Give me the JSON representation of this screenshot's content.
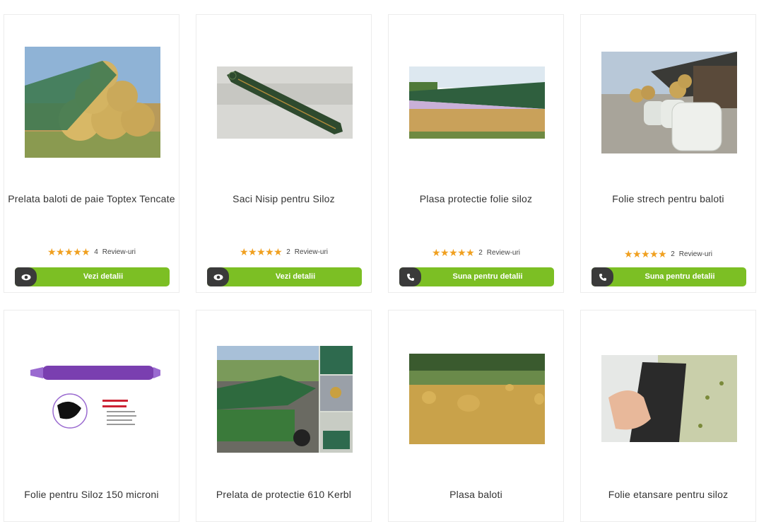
{
  "products": [
    {
      "title": "Prelata baloti de paie Toptex Tencate",
      "stars": "★★★★★",
      "reviews_count": "4",
      "reviews_label": "Review-uri",
      "button": "Vezi detalii",
      "icon": "eye-icon"
    },
    {
      "title": "Saci Nisip pentru Siloz",
      "stars": "★★★★★",
      "reviews_count": "2",
      "reviews_label": "Review-uri",
      "button": "Vezi detalii",
      "icon": "eye-icon"
    },
    {
      "title": "Plasa protectie folie siloz",
      "stars": "★★★★★",
      "reviews_count": "2",
      "reviews_label": "Review-uri",
      "button": "Suna pentru detalii",
      "icon": "phone-icon"
    },
    {
      "title": "Folie strech pentru baloti",
      "stars": "★★★★★",
      "reviews_count": "2",
      "reviews_label": "Review-uri",
      "button": "Suna pentru detalii",
      "icon": "phone-icon"
    },
    {
      "title": "Folie pentru Siloz 150 microni",
      "icon": "product-image"
    },
    {
      "title": "Prelata de protectie 610 Kerbl",
      "icon": "product-image"
    },
    {
      "title": "Plasa baloti",
      "icon": "product-image"
    },
    {
      "title": "Folie etansare pentru siloz",
      "icon": "product-image"
    }
  ],
  "colors": {
    "accent": "#7cbf24",
    "icon_bg": "#3a3a3a",
    "star": "#f0a020"
  }
}
